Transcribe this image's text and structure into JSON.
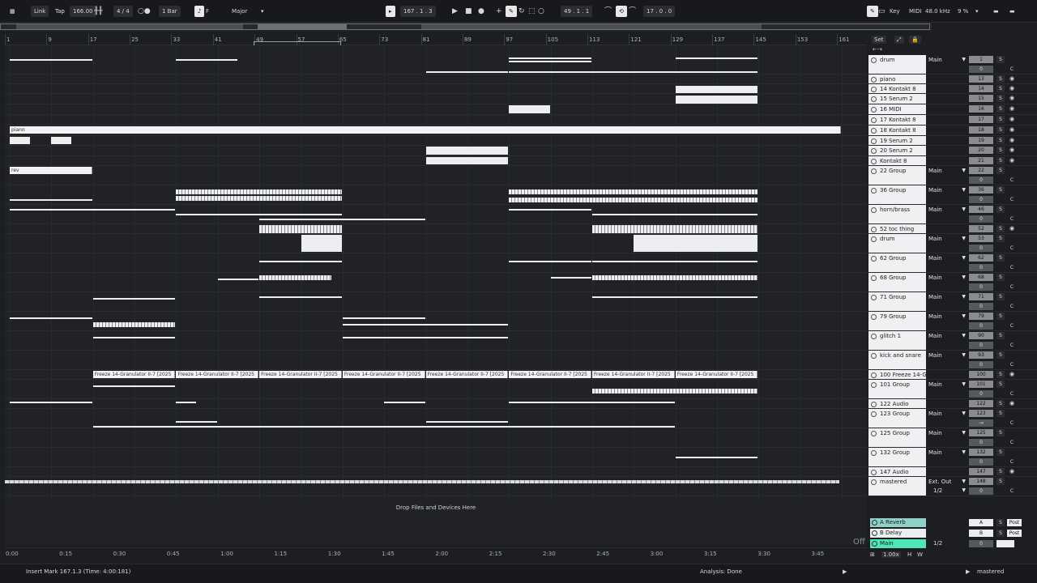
{
  "topbar": {
    "link": "Link",
    "tap": "Tap",
    "tempo": "166.00",
    "meter": "4 / 4",
    "quantize": "1 Bar",
    "key_root": "F",
    "scale": "Major",
    "position": "167 .  1 .  3",
    "loop_start": "49 .  1 .  1",
    "loop_length": "17 .  0 .  0",
    "key": "Key",
    "midi": "MIDI",
    "sample_rate": "48.0 kHz",
    "cpu": "9 %"
  },
  "ruler": {
    "bars": [
      "1",
      "9",
      "17",
      "25",
      "33",
      "41",
      "49",
      "57",
      "65",
      "73",
      "81",
      "89",
      "97",
      "105",
      "113",
      "121",
      "129",
      "137",
      "145",
      "153",
      "161"
    ]
  },
  "set_panel": {
    "set_label": "Set"
  },
  "tracks": [
    {
      "name": "drum",
      "route": "Main",
      "num": "1",
      "vol": "0",
      "h": 24
    },
    {
      "name": "piano",
      "route": "",
      "num": "13",
      "vol": "",
      "h": 12
    },
    {
      "name": "14 Kontakt 8",
      "route": "",
      "num": "14",
      "vol": "",
      "h": 12
    },
    {
      "name": "15 Serum 2",
      "route": "",
      "num": "15",
      "vol": "",
      "h": 13
    },
    {
      "name": "16 MIDI",
      "route": "",
      "num": "16",
      "vol": "",
      "h": 13
    },
    {
      "name": "17 Kontakt 8",
      "route": "",
      "num": "17",
      "vol": "",
      "h": 13
    },
    {
      "name": "18 Kontakt 8",
      "route": "",
      "num": "18",
      "vol": "",
      "h": 13
    },
    {
      "name": "19 Serum 2",
      "route": "",
      "num": "19",
      "vol": "",
      "h": 12
    },
    {
      "name": "20 Serum 2",
      "route": "",
      "num": "20",
      "vol": "",
      "h": 13
    },
    {
      "name": "Kontakt 8",
      "route": "",
      "num": "21",
      "vol": "",
      "h": 12
    },
    {
      "name": "22 Group",
      "route": "Main",
      "num": "22",
      "vol": "0",
      "h": 24
    },
    {
      "name": "36 Group",
      "route": "Main",
      "num": "36",
      "vol": "0",
      "h": 24
    },
    {
      "name": "horn/brass",
      "route": "Main",
      "num": "46",
      "vol": "0",
      "h": 24
    },
    {
      "name": "52 toc thing",
      "route": "",
      "num": "52",
      "vol": "",
      "h": 12
    },
    {
      "name": "drum",
      "route": "Main",
      "num": "53",
      "vol": "0",
      "h": 24
    },
    {
      "name": "62 Group",
      "route": "Main",
      "num": "62",
      "vol": "0",
      "h": 24
    },
    {
      "name": "68 Group",
      "route": "Main",
      "num": "68",
      "vol": "0",
      "h": 24
    },
    {
      "name": "71 Group",
      "route": "Main",
      "num": "71",
      "vol": "0",
      "h": 24
    },
    {
      "name": "79 Group",
      "route": "Main",
      "num": "79",
      "vol": "0",
      "h": 24
    },
    {
      "name": "glitch 1",
      "route": "Main",
      "num": "90",
      "vol": "0",
      "h": 24
    },
    {
      "name": "kick and snare",
      "route": "Main",
      "num": "93",
      "vol": "0",
      "h": 24
    },
    {
      "name": "100 Freeze 14-G",
      "route": "",
      "num": "100",
      "vol": "",
      "h": 12
    },
    {
      "name": "101 Group",
      "route": "Main",
      "num": "101",
      "vol": "0",
      "h": 24
    },
    {
      "name": "122 Audio",
      "route": "",
      "num": "122",
      "vol": "",
      "h": 12
    },
    {
      "name": "123 Group",
      "route": "Main",
      "num": "123",
      "vol": "-∞",
      "h": 24
    },
    {
      "name": "125 Group",
      "route": "Main",
      "num": "125",
      "vol": "0",
      "h": 24
    },
    {
      "name": "132 Group",
      "route": "Main",
      "num": "132",
      "vol": "0",
      "h": 24
    },
    {
      "name": "147 Audio",
      "route": "",
      "num": "147",
      "vol": "",
      "h": 12
    },
    {
      "name": "mastered",
      "route": "Ext. Out",
      "route2": "1/2",
      "num": "148",
      "vol": "0",
      "h": 24
    }
  ],
  "returns": [
    {
      "name": "A Reverb",
      "letter": "A",
      "color": "#8fd1c8"
    },
    {
      "name": "B Delay",
      "letter": "B",
      "color": "#eceef0"
    },
    {
      "name": "Main",
      "letter": "",
      "color": "#4ee6b4",
      "route": "1/2",
      "vol": "0"
    }
  ],
  "arrangement": {
    "clip_labels": {
      "piano": "piano",
      "rev": "rev",
      "freeze": "Freeze 14-Granulator II-7 [2025"
    },
    "drop_text": "Drop Files and Devices Here"
  },
  "time_ruler": [
    "0:00",
    "0:15",
    "0:30",
    "0:45",
    "1:00",
    "1:15",
    "1:30",
    "1:45",
    "2:00",
    "2:15",
    "2:30",
    "2:45",
    "3:00",
    "3:15",
    "3:30",
    "3:45"
  ],
  "off_label": "Off",
  "zoom": "1.00x",
  "status": {
    "message": "Insert Mark 167.1.3 (Time: 4:00:181)",
    "analysis": "Analysis: Done",
    "track": "mastered"
  },
  "colors": {
    "bg": "#1c1e22",
    "clip": "#eceef0",
    "reverb": "#8fd1c8",
    "main": "#4ee6b4"
  }
}
